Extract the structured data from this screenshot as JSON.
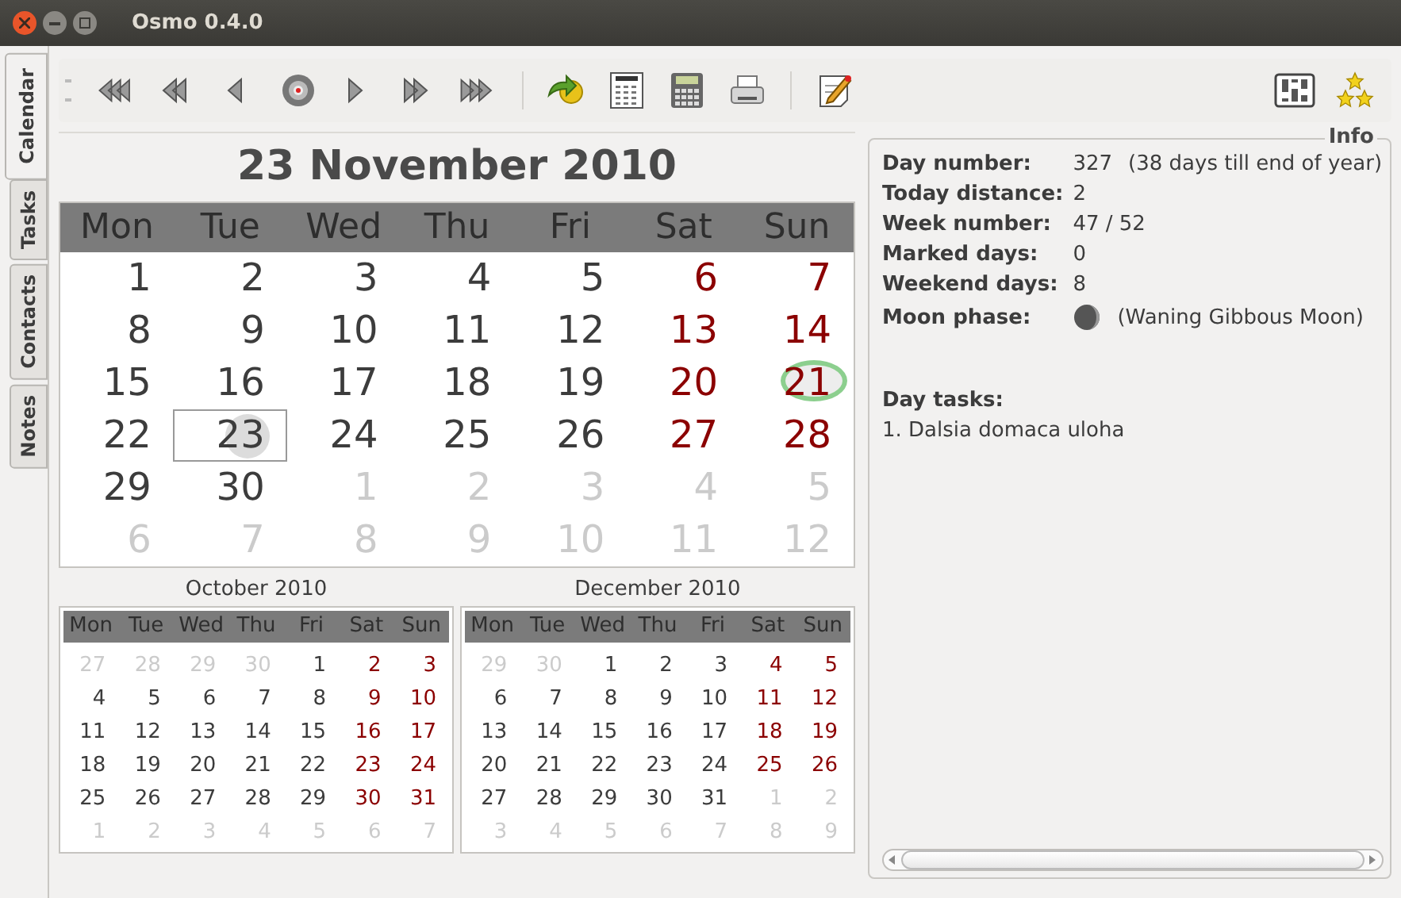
{
  "window": {
    "title": "Osmo 0.4.0"
  },
  "tabs": [
    {
      "label": "Calendar",
      "selected": true
    },
    {
      "label": "Tasks",
      "selected": false
    },
    {
      "label": "Contacts",
      "selected": false
    },
    {
      "label": "Notes",
      "selected": false
    }
  ],
  "calendar": {
    "title": "23 November 2010",
    "weekdays": [
      "Mon",
      "Tue",
      "Wed",
      "Thu",
      "Fri",
      "Sat",
      "Sun"
    ],
    "days": [
      {
        "d": "1",
        "kind": "day",
        "selected": false,
        "today": false
      },
      {
        "d": "2",
        "kind": "day",
        "selected": false,
        "today": false
      },
      {
        "d": "3",
        "kind": "day",
        "selected": false,
        "today": false
      },
      {
        "d": "4",
        "kind": "day",
        "selected": false,
        "today": false
      },
      {
        "d": "5",
        "kind": "day",
        "selected": false,
        "today": false
      },
      {
        "d": "6",
        "kind": "weekend",
        "selected": false,
        "today": false
      },
      {
        "d": "7",
        "kind": "weekend",
        "selected": false,
        "today": false
      },
      {
        "d": "8",
        "kind": "day",
        "selected": false,
        "today": false
      },
      {
        "d": "9",
        "kind": "day",
        "selected": false,
        "today": false
      },
      {
        "d": "10",
        "kind": "day",
        "selected": false,
        "today": false
      },
      {
        "d": "11",
        "kind": "day",
        "selected": false,
        "today": false
      },
      {
        "d": "12",
        "kind": "day",
        "selected": false,
        "today": false
      },
      {
        "d": "13",
        "kind": "weekend",
        "selected": false,
        "today": false
      },
      {
        "d": "14",
        "kind": "weekend",
        "selected": false,
        "today": false
      },
      {
        "d": "15",
        "kind": "day",
        "selected": false,
        "today": false
      },
      {
        "d": "16",
        "kind": "day",
        "selected": false,
        "today": false
      },
      {
        "d": "17",
        "kind": "day",
        "selected": false,
        "today": false
      },
      {
        "d": "18",
        "kind": "day",
        "selected": false,
        "today": false
      },
      {
        "d": "19",
        "kind": "day",
        "selected": false,
        "today": false
      },
      {
        "d": "20",
        "kind": "weekend",
        "selected": false,
        "today": false
      },
      {
        "d": "21",
        "kind": "weekend",
        "selected": false,
        "today": true
      },
      {
        "d": "22",
        "kind": "day",
        "selected": false,
        "today": false
      },
      {
        "d": "23",
        "kind": "day",
        "selected": true,
        "today": false
      },
      {
        "d": "24",
        "kind": "day",
        "selected": false,
        "today": false
      },
      {
        "d": "25",
        "kind": "day",
        "selected": false,
        "today": false
      },
      {
        "d": "26",
        "kind": "day",
        "selected": false,
        "today": false
      },
      {
        "d": "27",
        "kind": "weekend",
        "selected": false,
        "today": false
      },
      {
        "d": "28",
        "kind": "weekend",
        "selected": false,
        "today": false
      },
      {
        "d": "29",
        "kind": "day",
        "selected": false,
        "today": false
      },
      {
        "d": "30",
        "kind": "day",
        "selected": false,
        "today": false
      },
      {
        "d": "1",
        "kind": "outside",
        "selected": false,
        "today": false
      },
      {
        "d": "2",
        "kind": "outside",
        "selected": false,
        "today": false
      },
      {
        "d": "3",
        "kind": "outside",
        "selected": false,
        "today": false
      },
      {
        "d": "4",
        "kind": "outside",
        "selected": false,
        "today": false
      },
      {
        "d": "5",
        "kind": "outside",
        "selected": false,
        "today": false
      },
      {
        "d": "6",
        "kind": "outside",
        "selected": false,
        "today": false
      },
      {
        "d": "7",
        "kind": "outside",
        "selected": false,
        "today": false
      },
      {
        "d": "8",
        "kind": "outside",
        "selected": false,
        "today": false
      },
      {
        "d": "9",
        "kind": "outside",
        "selected": false,
        "today": false
      },
      {
        "d": "10",
        "kind": "outside",
        "selected": false,
        "today": false
      },
      {
        "d": "11",
        "kind": "outside",
        "selected": false,
        "today": false
      },
      {
        "d": "12",
        "kind": "outside",
        "selected": false,
        "today": false
      }
    ]
  },
  "mini_calendars": [
    {
      "title": "October 2010",
      "weekdays": [
        "Mon",
        "Tue",
        "Wed",
        "Thu",
        "Fri",
        "Sat",
        "Sun"
      ],
      "days": [
        {
          "d": "27",
          "kind": "outside"
        },
        {
          "d": "28",
          "kind": "outside"
        },
        {
          "d": "29",
          "kind": "outside"
        },
        {
          "d": "30",
          "kind": "outside"
        },
        {
          "d": "1",
          "kind": "day"
        },
        {
          "d": "2",
          "kind": "weekend"
        },
        {
          "d": "3",
          "kind": "weekend"
        },
        {
          "d": "4",
          "kind": "day"
        },
        {
          "d": "5",
          "kind": "day"
        },
        {
          "d": "6",
          "kind": "day"
        },
        {
          "d": "7",
          "kind": "day"
        },
        {
          "d": "8",
          "kind": "day"
        },
        {
          "d": "9",
          "kind": "weekend"
        },
        {
          "d": "10",
          "kind": "weekend"
        },
        {
          "d": "11",
          "kind": "day"
        },
        {
          "d": "12",
          "kind": "day"
        },
        {
          "d": "13",
          "kind": "day"
        },
        {
          "d": "14",
          "kind": "day"
        },
        {
          "d": "15",
          "kind": "day"
        },
        {
          "d": "16",
          "kind": "weekend"
        },
        {
          "d": "17",
          "kind": "weekend"
        },
        {
          "d": "18",
          "kind": "day"
        },
        {
          "d": "19",
          "kind": "day"
        },
        {
          "d": "20",
          "kind": "day"
        },
        {
          "d": "21",
          "kind": "day"
        },
        {
          "d": "22",
          "kind": "day"
        },
        {
          "d": "23",
          "kind": "weekend"
        },
        {
          "d": "24",
          "kind": "weekend"
        },
        {
          "d": "25",
          "kind": "day"
        },
        {
          "d": "26",
          "kind": "day"
        },
        {
          "d": "27",
          "kind": "day"
        },
        {
          "d": "28",
          "kind": "day"
        },
        {
          "d": "29",
          "kind": "day"
        },
        {
          "d": "30",
          "kind": "weekend"
        },
        {
          "d": "31",
          "kind": "weekend"
        },
        {
          "d": "1",
          "kind": "outside"
        },
        {
          "d": "2",
          "kind": "outside"
        },
        {
          "d": "3",
          "kind": "outside"
        },
        {
          "d": "4",
          "kind": "outside"
        },
        {
          "d": "5",
          "kind": "outside"
        },
        {
          "d": "6",
          "kind": "outside"
        },
        {
          "d": "7",
          "kind": "outside"
        }
      ]
    },
    {
      "title": "December 2010",
      "weekdays": [
        "Mon",
        "Tue",
        "Wed",
        "Thu",
        "Fri",
        "Sat",
        "Sun"
      ],
      "days": [
        {
          "d": "29",
          "kind": "outside"
        },
        {
          "d": "30",
          "kind": "outside"
        },
        {
          "d": "1",
          "kind": "day"
        },
        {
          "d": "2",
          "kind": "day"
        },
        {
          "d": "3",
          "kind": "day"
        },
        {
          "d": "4",
          "kind": "weekend"
        },
        {
          "d": "5",
          "kind": "weekend"
        },
        {
          "d": "6",
          "kind": "day"
        },
        {
          "d": "7",
          "kind": "day"
        },
        {
          "d": "8",
          "kind": "day"
        },
        {
          "d": "9",
          "kind": "day"
        },
        {
          "d": "10",
          "kind": "day"
        },
        {
          "d": "11",
          "kind": "weekend"
        },
        {
          "d": "12",
          "kind": "weekend"
        },
        {
          "d": "13",
          "kind": "day"
        },
        {
          "d": "14",
          "kind": "day"
        },
        {
          "d": "15",
          "kind": "day"
        },
        {
          "d": "16",
          "kind": "day"
        },
        {
          "d": "17",
          "kind": "day"
        },
        {
          "d": "18",
          "kind": "weekend"
        },
        {
          "d": "19",
          "kind": "weekend"
        },
        {
          "d": "20",
          "kind": "day"
        },
        {
          "d": "21",
          "kind": "day"
        },
        {
          "d": "22",
          "kind": "day"
        },
        {
          "d": "23",
          "kind": "day"
        },
        {
          "d": "24",
          "kind": "day"
        },
        {
          "d": "25",
          "kind": "weekend"
        },
        {
          "d": "26",
          "kind": "weekend"
        },
        {
          "d": "27",
          "kind": "day"
        },
        {
          "d": "28",
          "kind": "day"
        },
        {
          "d": "29",
          "kind": "day"
        },
        {
          "d": "30",
          "kind": "day"
        },
        {
          "d": "31",
          "kind": "day"
        },
        {
          "d": "1",
          "kind": "outside"
        },
        {
          "d": "2",
          "kind": "outside"
        },
        {
          "d": "3",
          "kind": "outside"
        },
        {
          "d": "4",
          "kind": "outside"
        },
        {
          "d": "5",
          "kind": "outside"
        },
        {
          "d": "6",
          "kind": "outside"
        },
        {
          "d": "7",
          "kind": "outside"
        },
        {
          "d": "8",
          "kind": "outside"
        },
        {
          "d": "9",
          "kind": "outside"
        }
      ]
    }
  ],
  "info": {
    "title": "Info",
    "rows": [
      {
        "label": "Day number:",
        "value": "327",
        "note": "(38 days till end of year)"
      },
      {
        "label": "Today distance:",
        "value": "2"
      },
      {
        "label": "Week number:",
        "value": "47 / 52"
      },
      {
        "label": "Marked days:",
        "value": "0"
      },
      {
        "label": "Weekend days:",
        "value": "8"
      },
      {
        "label": "Moon phase:",
        "kind": "moon",
        "note": "(Waning Gibbous Moon)"
      }
    ],
    "tasks_title": "Day tasks:",
    "tasks": [
      "1. Dalsia domaca uloha"
    ]
  }
}
